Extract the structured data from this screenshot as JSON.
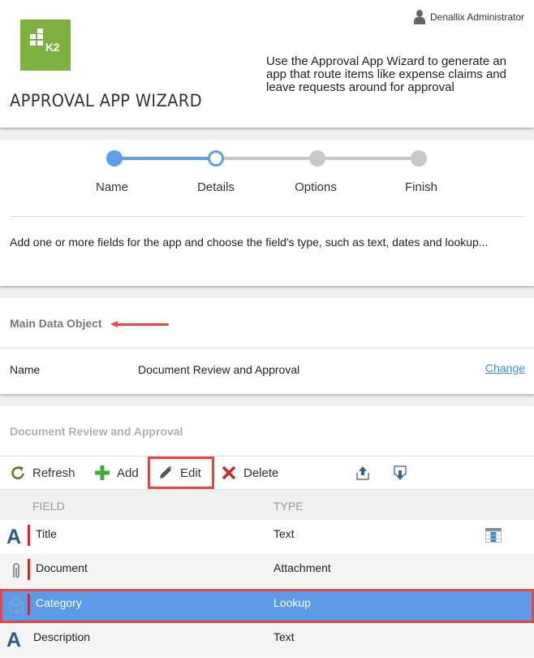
{
  "header": {
    "logo_text": "K2",
    "title": "APPROVAL APP WIZARD",
    "user_name": "Denallix Administrator",
    "intro": "Use the Approval App Wizard to generate an app that route items like expense claims and leave requests around for approval"
  },
  "wizard": {
    "steps": [
      {
        "label": "Name",
        "state": "completed"
      },
      {
        "label": "Details",
        "state": "current"
      },
      {
        "label": "Options",
        "state": "pending"
      },
      {
        "label": "Finish",
        "state": "pending"
      }
    ],
    "instructions": "Add one or more fields for the app and choose the field's type, such as text, dates and lookup..."
  },
  "main_data_object": {
    "title": "Main Data Object",
    "name_label": "Name",
    "name_value": "Document Review and Approval",
    "change_link": "Change"
  },
  "fields_section": {
    "title": "Document Review and Approval",
    "toolbar": {
      "refresh": "Refresh",
      "add": "Add",
      "edit": "Edit",
      "delete": "Delete"
    },
    "columns": [
      "FIELD",
      "TYPE"
    ],
    "rows": [
      {
        "icon": "text-icon",
        "field": "Title",
        "type": "Text",
        "required": true,
        "selected": false
      },
      {
        "icon": "paperclip-icon",
        "field": "Document",
        "type": "Attachment",
        "required": true,
        "selected": false
      },
      {
        "icon": "cube-icon",
        "field": "Category",
        "type": "Lookup",
        "required": true,
        "selected": true
      },
      {
        "icon": "text-icon",
        "field": "Description",
        "type": "Text",
        "required": false,
        "selected": false
      }
    ]
  },
  "colors": {
    "brand_green": "#7fb141",
    "accent_blue": "#5ba0e8",
    "selection_blue": "#5b9be8",
    "highlight_red": "#e84545",
    "link_blue": "#3d8fd8"
  }
}
